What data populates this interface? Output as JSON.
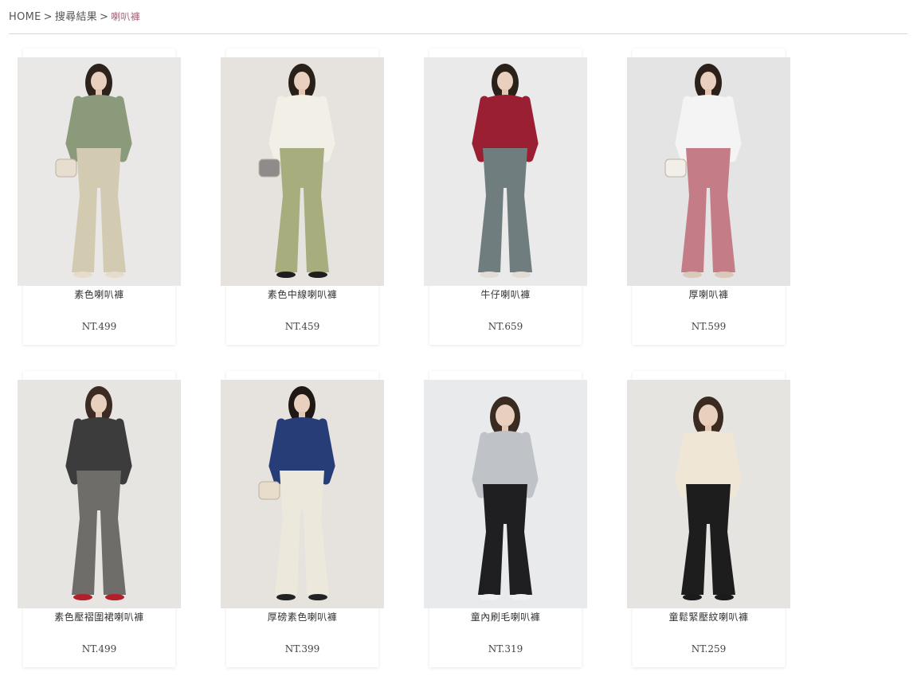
{
  "breadcrumb": {
    "home": "HOME",
    "separator": ">",
    "search": "搜尋結果",
    "current": "喇叭褲"
  },
  "products": [
    {
      "name": "素色喇叭褲",
      "price": "NT.499",
      "bg": "#e9e8e6",
      "top": "#8c9a7c",
      "pants": "#d3cbb1",
      "hair": "#2d221c",
      "shoes": "#e6dccb",
      "bag": "#e8ded0"
    },
    {
      "name": "素色中線喇叭褲",
      "price": "NT.459",
      "bg": "#e6e2de",
      "top": "#f2efe7",
      "pants": "#a8ad7e",
      "hair": "#2a201a",
      "shoes": "#1e1e1e",
      "bag": "#8e8c8a"
    },
    {
      "name": "牛仔喇叭褲",
      "price": "NT.659",
      "bg": "#eaeaea",
      "top": "#9a1f33",
      "pants": "#6f7d7f",
      "hair": "#2a211b",
      "shoes": "#e2dcd4",
      "bag": ""
    },
    {
      "name": "厚喇叭褲",
      "price": "NT.599",
      "bg": "#e4e4e4",
      "top": "#f4f4f4",
      "pants": "#c47d86",
      "hair": "#2b201a",
      "shoes": "#d8c9bb",
      "bag": "#f2eee8"
    },
    {
      "name": "素色壓褶圍裙喇叭褲",
      "price": "NT.499",
      "bg": "#e7e5e2",
      "top": "#3c3c3c",
      "pants": "#6e6d69",
      "hair": "#3b2b22",
      "shoes": "#b2202c",
      "bag": ""
    },
    {
      "name": "厚磅素色喇叭褲",
      "price": "NT.399",
      "bg": "#e6e3df",
      "top": "#263d78",
      "pants": "#ece8dc",
      "hair": "#1f1815",
      "shoes": "#222222",
      "bag": "#e8dccb"
    },
    {
      "name": "童內刷毛喇叭褲",
      "price": "NT.319",
      "bg": "#e8eaec",
      "top": "#bfc3c8",
      "pants": "#1f1f22",
      "hair": "#3a2b20",
      "shoes": "#f0f0f0",
      "bag": ""
    },
    {
      "name": "童鬆緊壓紋喇叭褲",
      "price": "NT.259",
      "bg": "#e6e4e1",
      "top": "#efe6d6",
      "pants": "#1d1d1d",
      "hair": "#3a2a1f",
      "shoes": "#1b1b1b",
      "bag": ""
    }
  ]
}
